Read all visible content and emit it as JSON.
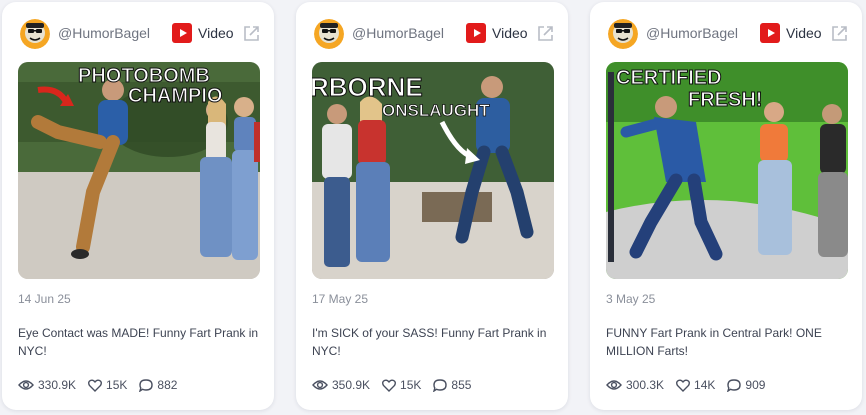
{
  "cards": [
    {
      "handle": "@HumorBagel",
      "type_label": "Video",
      "date": "14 Jun 25",
      "title": "Eye Contact was MADE! Funny Fart Prank in NYC!",
      "views": "330.9K",
      "likes": "15K",
      "comments": "882",
      "thumbnail": {
        "overlay_lines": [
          "PHOTOBOMB",
          "CHAMPIO"
        ]
      }
    },
    {
      "handle": "@HumorBagel",
      "type_label": "Video",
      "date": "17 May 25",
      "title": "I'm SICK of your SASS! Funny Fart Prank in NYC!",
      "views": "350.9K",
      "likes": "15K",
      "comments": "855",
      "thumbnail": {
        "overlay_lines": [
          "RBORNE",
          "ONSLAUGHT"
        ]
      }
    },
    {
      "handle": "@HumorBagel",
      "type_label": "Video",
      "date": "3 May 25",
      "title": "FUNNY Fart Prank in Central Park! ONE MILLION Farts!",
      "views": "300.3K",
      "likes": "14K",
      "comments": "909",
      "thumbnail": {
        "overlay_lines": [
          "CERTIFIED",
          "FRESH!"
        ]
      }
    }
  ],
  "icons": {
    "avatar": "avatar-icon",
    "platform": "youtube-icon",
    "external": "external-link-icon",
    "views": "eye-icon",
    "likes": "heart-icon",
    "comments": "comment-icon"
  },
  "colors": {
    "card_bg": "#ffffff",
    "page_bg": "#f2f3f7",
    "youtube_red": "#e21b1b",
    "muted_text": "#8a8f9a"
  }
}
